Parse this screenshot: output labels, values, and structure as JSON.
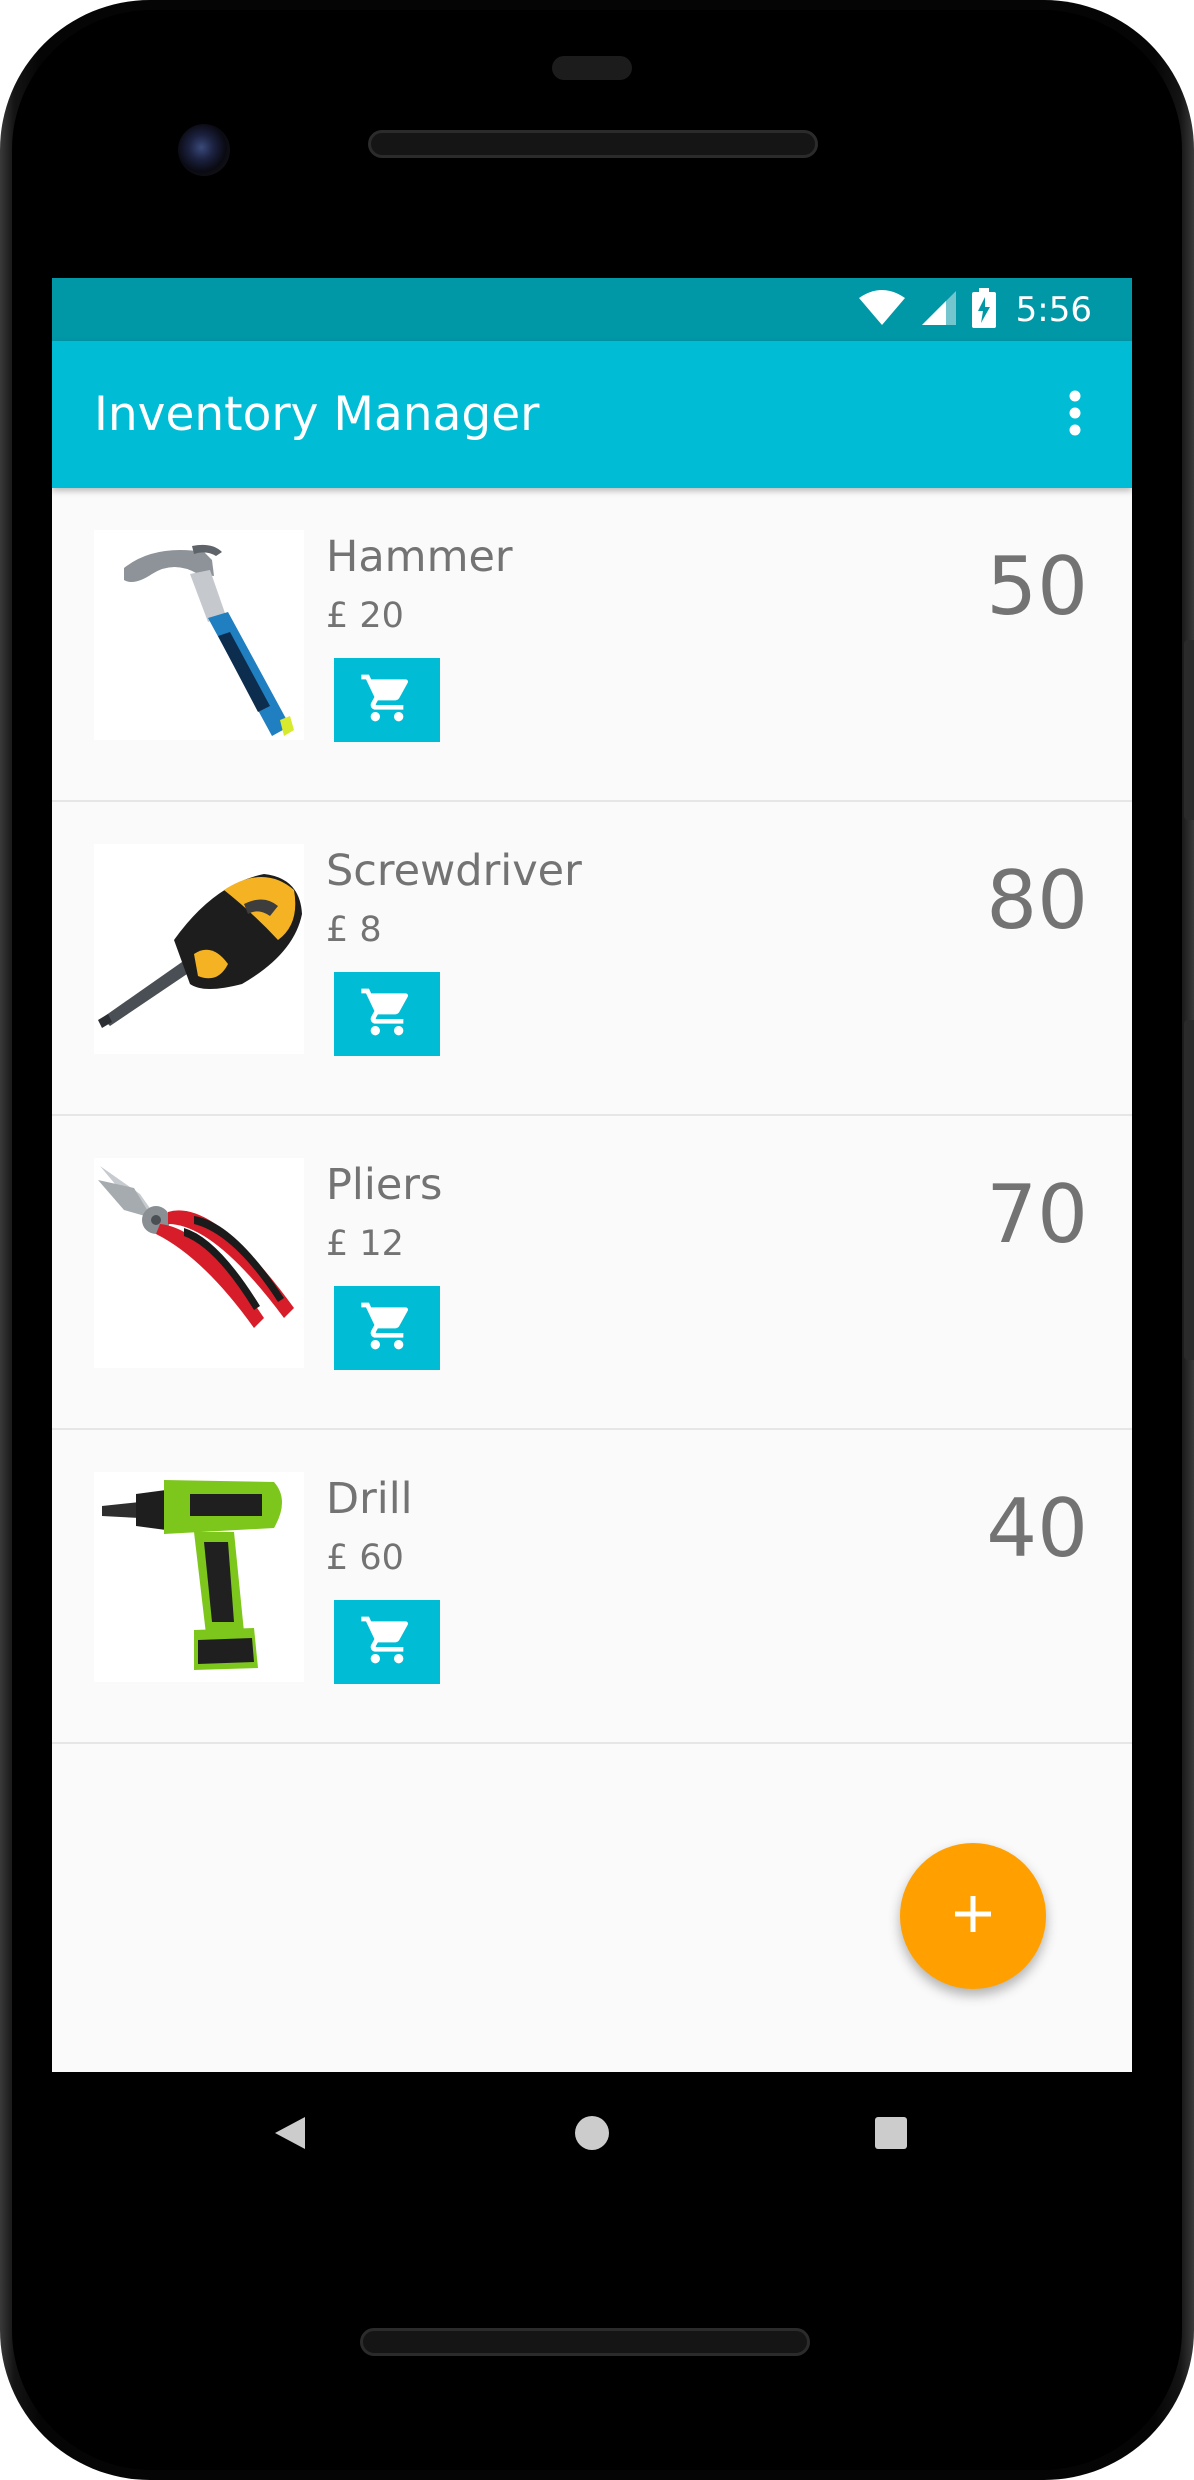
{
  "status_bar": {
    "time": "5:56",
    "icons": [
      "wifi-icon",
      "signal-icon",
      "battery-charging-icon"
    ]
  },
  "app_bar": {
    "title": "Inventory Manager",
    "overflow_icon": "more-vert-icon"
  },
  "inventory": {
    "items": [
      {
        "name": "Hammer",
        "price": "£ 20",
        "quantity": "50",
        "image": "hammer-image",
        "cart_icon": "cart-icon"
      },
      {
        "name": "Screwdriver",
        "price": "£ 8",
        "quantity": "80",
        "image": "screwdriver-image",
        "cart_icon": "cart-icon"
      },
      {
        "name": "Pliers",
        "price": "£ 12",
        "quantity": "70",
        "image": "pliers-image",
        "cart_icon": "cart-icon"
      },
      {
        "name": "Drill",
        "price": "£ 60",
        "quantity": "40",
        "image": "drill-image",
        "cart_icon": "cart-icon"
      }
    ]
  },
  "fab": {
    "icon": "add-icon"
  },
  "navigation": {
    "buttons": [
      "back-icon",
      "home-icon",
      "recents-icon"
    ]
  },
  "colors": {
    "primary": "#00bcd4",
    "primary_dark": "#0097a7",
    "accent": "#ffa000",
    "text_secondary": "#737373",
    "background": "#fafafa"
  }
}
